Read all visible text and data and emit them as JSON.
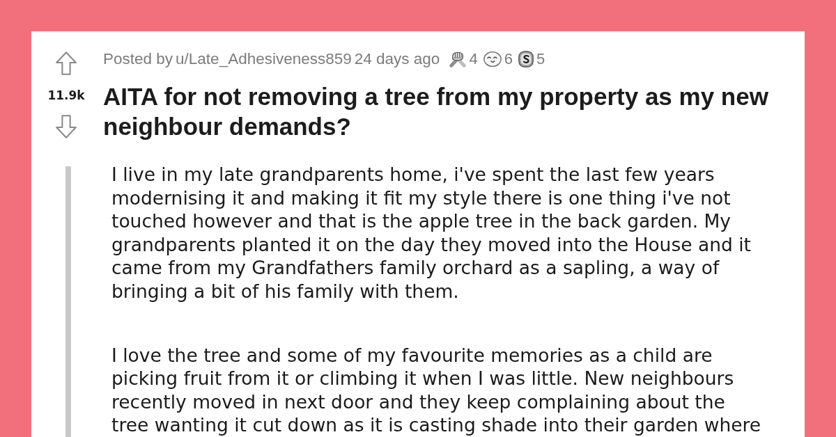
{
  "post": {
    "score": "11.9k",
    "posted_prefix": "Posted by",
    "author": "u/Late_Adhesiveness859",
    "time": "24 days ago",
    "awards": [
      {
        "kind": "handshake",
        "count": "4"
      },
      {
        "kind": "smiley",
        "count": "6"
      },
      {
        "kind": "coin",
        "count": "5"
      }
    ],
    "title": "AITA for not removing a tree from my property as my new neighbour demands?",
    "body": [
      "I live in my late grandparents home, i've spent the last few years modernising it and making it fit my style there is one thing i've not touched however and that is the apple tree in the back garden. My grandparents planted it on the day they moved into the House and it came from my Grandfathers family orchard as a sapling, a way of bringing a bit of his family with them.",
      "I love the tree and some of my favourite memories as a child are picking fruit from it or climbing it when I was little. New neighbours recently moved in next door and they keep complaining about the tree wanting it cut down as it is casting shade into their garden where"
    ]
  }
}
